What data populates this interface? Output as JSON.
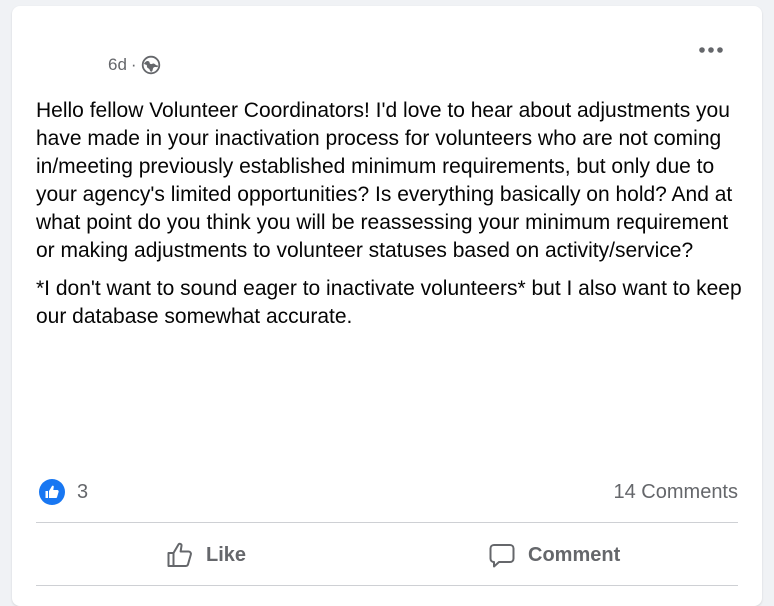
{
  "post": {
    "timestamp": "6d",
    "separator": "·",
    "audience_icon": "globe-icon",
    "more_icon": "ellipsis-icon",
    "paragraphs": [
      "Hello fellow Volunteer Coordinators! I'd love to hear about adjustments you have made in your inactivation process for volunteers who are not coming in/meeting previously established minimum requirements, but only due to your agency's limited opportunities? Is everything basically on hold? And at what point do you think you will be reassessing your minimum requirement or making adjustments to volunteer statuses based on activity/service?",
      "*I don't want to sound eager to inactivate volunteers* but I also want to keep our database somewhat accurate."
    ]
  },
  "stats": {
    "reaction_count": "3",
    "comments_label": "14 Comments"
  },
  "actions": {
    "like_label": "Like",
    "comment_label": "Comment"
  },
  "colors": {
    "accent": "#1877f2",
    "secondary_text": "#65676b",
    "primary_text": "#050505",
    "divider": "#ced0d4"
  }
}
